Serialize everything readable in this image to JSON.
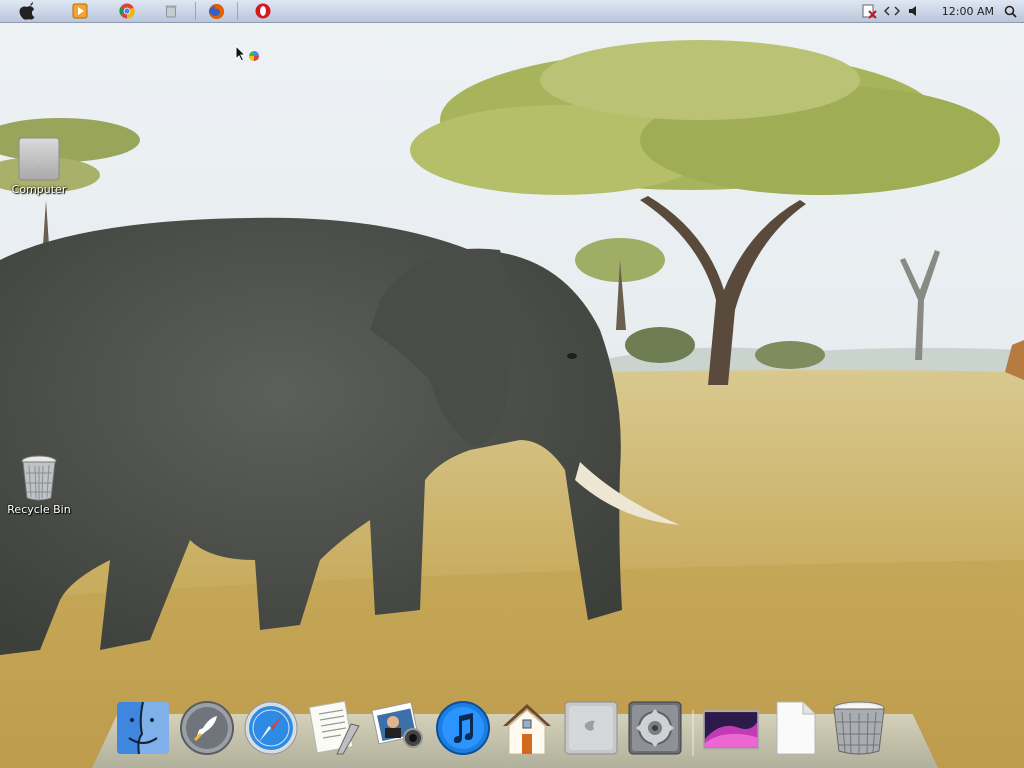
{
  "menubar": {
    "apple_icon": "apple-icon",
    "launchers": [
      {
        "name": "media-player-icon"
      },
      {
        "name": "chrome-icon"
      },
      {
        "name": "trash-small-icon"
      },
      {
        "name": "firefox-icon"
      },
      {
        "name": "opera-icon"
      }
    ],
    "tray": [
      "network-disconnected-icon",
      "code-icon",
      "volume-icon"
    ],
    "clock": "12:00 AM",
    "search_icon": "search-icon"
  },
  "desktop": {
    "icons": [
      {
        "label": "Computer",
        "icon": "computer-icon"
      },
      {
        "label": "Recycle Bin",
        "icon": "recycle-bin-icon"
      }
    ]
  },
  "dock": {
    "items": [
      {
        "icon": "finder-icon"
      },
      {
        "icon": "launchpad-icon"
      },
      {
        "icon": "safari-icon"
      },
      {
        "icon": "textedit-icon"
      },
      {
        "icon": "photo-booth-icon"
      },
      {
        "icon": "itunes-icon"
      },
      {
        "icon": "home-icon"
      },
      {
        "icon": "mac-pro-icon"
      },
      {
        "icon": "system-preferences-icon"
      },
      {
        "icon": "desktop-picture-icon"
      },
      {
        "icon": "document-icon"
      },
      {
        "icon": "trash-icon"
      }
    ]
  },
  "colors": {
    "sky": "#e9eef2",
    "grass": "#cdb36e",
    "menubar": "#c9d4e6"
  }
}
